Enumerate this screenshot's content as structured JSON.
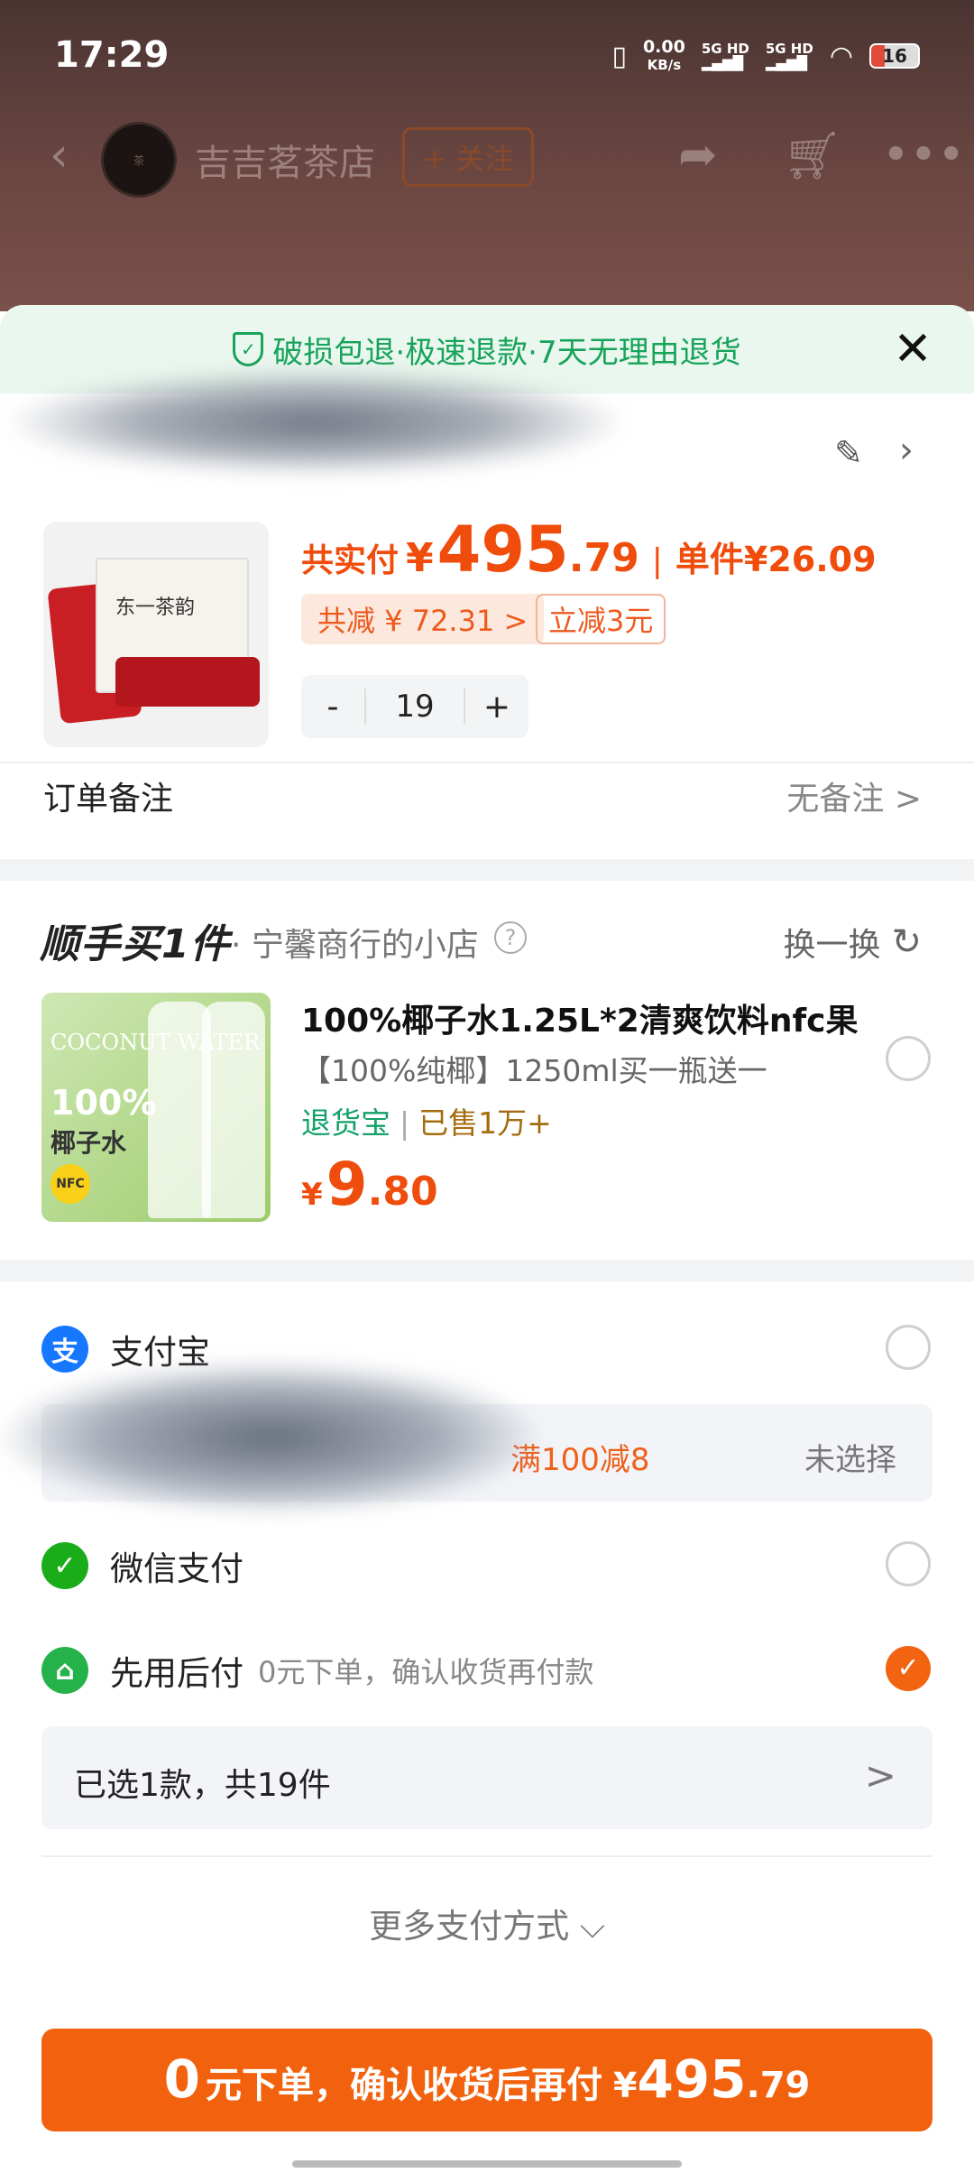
{
  "status_bar": {
    "time": "17:29",
    "net_speed": "0.00",
    "net_unit": "KB/s",
    "sig1": "5G HD",
    "sig2": "5G HD",
    "battery": "16"
  },
  "header": {
    "back_icon": "chevron-left-icon",
    "shop_name": "吉吉茗茶店",
    "follow_label": "+ 关注",
    "share_icon": "share-icon",
    "cart_icon": "cart-icon",
    "more_icon": "more-icon"
  },
  "sheet": {
    "banner": "破损包退·极速退款·7天无理由退货",
    "close_icon": "close-icon"
  },
  "product": {
    "box_text": "东一茶韵",
    "total_label": "共实付",
    "currency": "¥",
    "total_int": "495",
    "total_dec": ".79",
    "unit_label": "单件",
    "unit_price": "¥26.09",
    "discount_tag": "共减 ¥ 72.31 >",
    "cut_tag": "立减3元",
    "qty_minus": "-",
    "qty": "19",
    "qty_plus": "+"
  },
  "order_note": {
    "label": "订单备注",
    "value": "无备注 >"
  },
  "addon": {
    "title": "顺手买1件",
    "shop": "· 宁馨商行的小店",
    "help": "?",
    "swap_label": "换一换",
    "swap_icon": "refresh-icon",
    "img_text": "COCONUT WATER",
    "img_pct": "100%",
    "img_cn": "椰子水",
    "img_badge": "NFC",
    "title_text": "100%椰子水1.25L*2清爽饮料nfc果",
    "subtitle": "【100%纯椰】1250ml买一瓶送一",
    "tag_green": "退货宝",
    "tag_sep": "|",
    "tag_sold": "已售1万+",
    "price_cur": "¥",
    "price_int": "9",
    "price_dec": ".80"
  },
  "payment": {
    "alipay": "支付宝",
    "alipay_icon": "alipay-icon",
    "promo": "满100减8",
    "promo_state": "未选择",
    "wechat": "微信支付",
    "wechat_icon": "wechat-pay-icon",
    "later": "先用后付",
    "later_desc": "0元下单，确认收货再付款",
    "later_icon": "pay-later-icon",
    "selected": "later"
  },
  "summary": {
    "selected_text": "已选1款，共19件",
    "arrow": ">"
  },
  "more_pay": "更多支付方式 ⌵",
  "cta": {
    "zero": "0",
    "mid": "元下单，确认收货后再付",
    "cur": "¥",
    "int": "495",
    "dec": ".79"
  },
  "colors": {
    "accent": "#f2620e",
    "green": "#17a35a"
  }
}
